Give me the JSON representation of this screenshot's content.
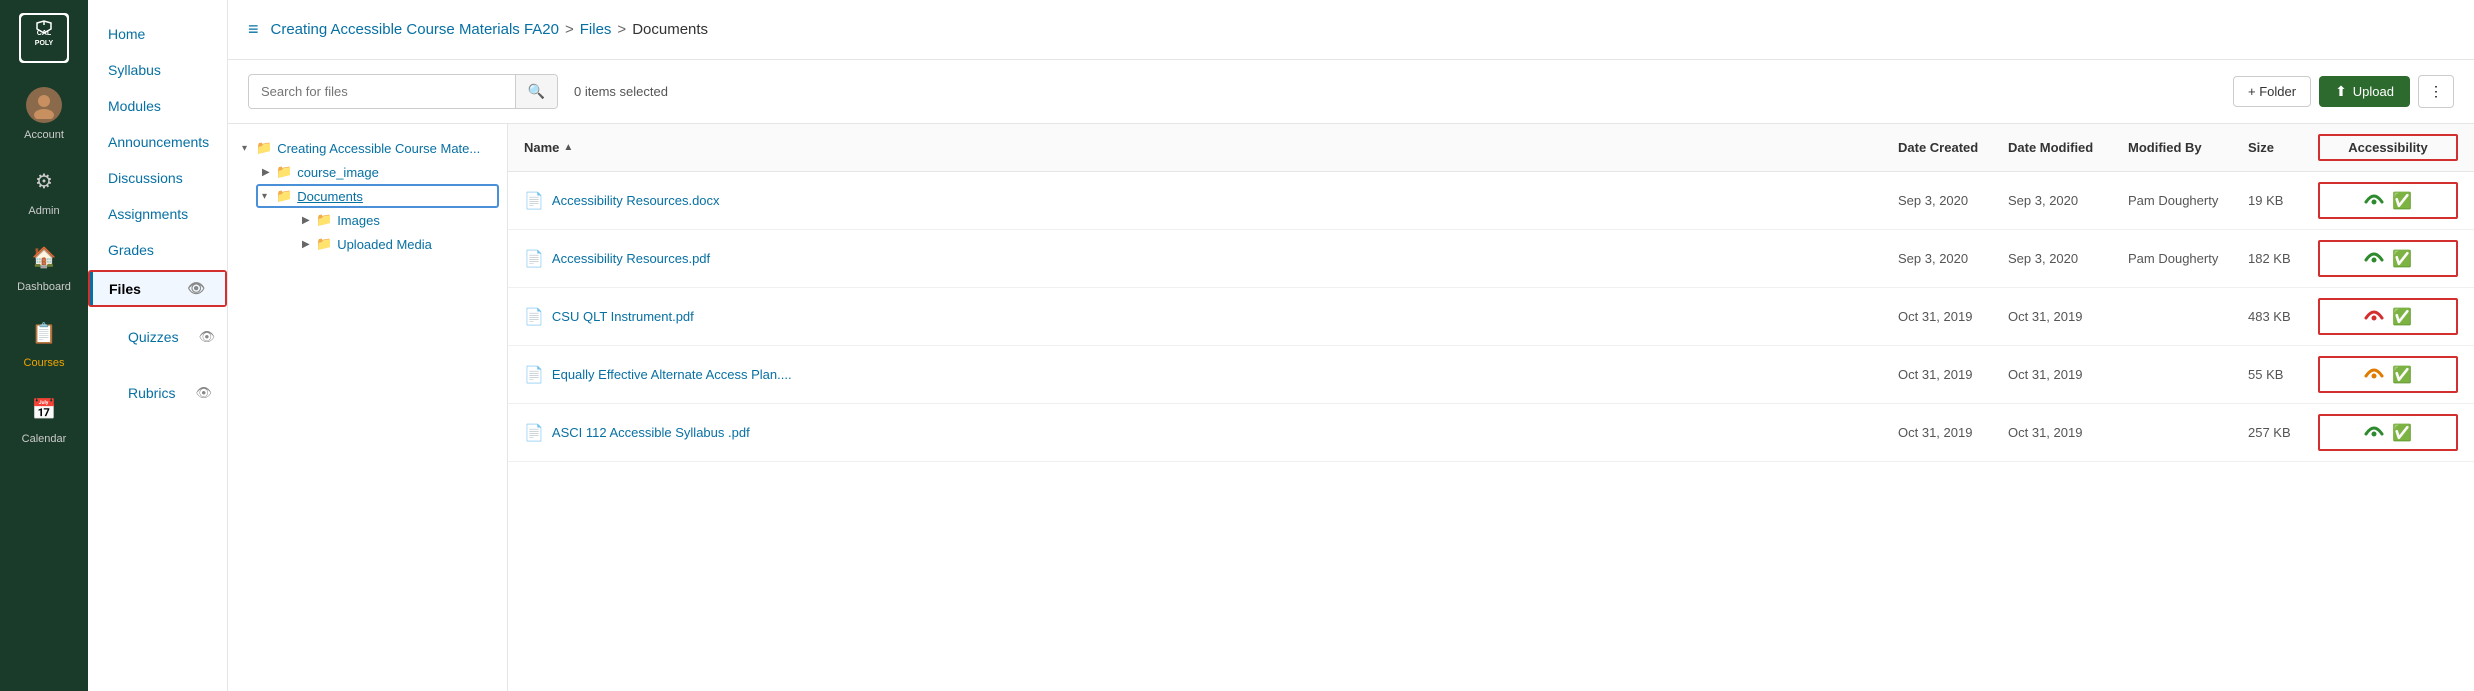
{
  "sidebar": {
    "logo": {
      "text": "CAL POLY"
    },
    "items": [
      {
        "id": "account",
        "label": "Account",
        "icon": "👤",
        "active": false
      },
      {
        "id": "admin",
        "label": "Admin",
        "icon": "⚙",
        "active": false
      },
      {
        "id": "dashboard",
        "label": "Dashboard",
        "icon": "🏠",
        "active": false
      },
      {
        "id": "courses",
        "label": "Courses",
        "icon": "📋",
        "active": true
      },
      {
        "id": "calendar",
        "label": "Calendar",
        "icon": "📅",
        "active": false
      }
    ]
  },
  "nav_panel": {
    "items": [
      {
        "id": "home",
        "label": "Home",
        "has_eye": false
      },
      {
        "id": "syllabus",
        "label": "Syllabus",
        "has_eye": false
      },
      {
        "id": "modules",
        "label": "Modules",
        "has_eye": false
      },
      {
        "id": "announcements",
        "label": "Announcements",
        "has_eye": false
      },
      {
        "id": "discussions",
        "label": "Discussions",
        "has_eye": false
      },
      {
        "id": "assignments",
        "label": "Assignments",
        "has_eye": false
      },
      {
        "id": "grades",
        "label": "Grades",
        "has_eye": false
      },
      {
        "id": "files",
        "label": "Files",
        "active": true,
        "has_eye": true
      },
      {
        "id": "quizzes",
        "label": "Quizzes",
        "has_eye": true
      },
      {
        "id": "rubrics",
        "label": "Rubrics",
        "has_eye": true
      }
    ]
  },
  "breadcrumb": {
    "course": "Creating Accessible Course Materials FA20",
    "files": "Files",
    "current": "Documents"
  },
  "toolbar": {
    "search_placeholder": "Search for files",
    "items_selected": "0 items selected",
    "folder_button": "+ Folder",
    "upload_button": "Upload",
    "more_button": "⋮"
  },
  "tree": {
    "root": "Creating Accessible Course Mate...",
    "children": [
      {
        "label": "course_image",
        "expanded": false,
        "selected": false
      },
      {
        "label": "Documents",
        "expanded": true,
        "selected": true,
        "children": [
          {
            "label": "Images",
            "expanded": false
          },
          {
            "label": "Uploaded Media",
            "expanded": false
          }
        ]
      }
    ]
  },
  "file_list": {
    "headers": {
      "name": "Name",
      "date_created": "Date Created",
      "date_modified": "Date Modified",
      "modified_by": "Modified By",
      "size": "Size",
      "accessibility": "Accessibility"
    },
    "files": [
      {
        "id": 1,
        "icon": "doc",
        "name": "Accessibility Resources.docx",
        "date_created": "Sep 3, 2020",
        "date_modified": "Sep 3, 2020",
        "modified_by": "Pam Dougherty",
        "size": "19 KB",
        "accessibility_status": "green",
        "check": "green"
      },
      {
        "id": 2,
        "icon": "pdf",
        "name": "Accessibility Resources.pdf",
        "date_created": "Sep 3, 2020",
        "date_modified": "Sep 3, 2020",
        "modified_by": "Pam Dougherty",
        "size": "182 KB",
        "accessibility_status": "green",
        "check": "green"
      },
      {
        "id": 3,
        "icon": "pdf",
        "name": "CSU QLT Instrument.pdf",
        "date_created": "Oct 31, 2019",
        "date_modified": "Oct 31, 2019",
        "modified_by": "",
        "size": "483 KB",
        "accessibility_status": "red",
        "check": "green"
      },
      {
        "id": 4,
        "icon": "doc",
        "name": "Equally Effective Alternate Access Plan....",
        "date_created": "Oct 31, 2019",
        "date_modified": "Oct 31, 2019",
        "modified_by": "",
        "size": "55 KB",
        "accessibility_status": "orange",
        "check": "green"
      },
      {
        "id": 5,
        "icon": "pdf",
        "name": "ASCI 112 Accessible Syllabus .pdf",
        "date_created": "Oct 31, 2019",
        "date_modified": "Oct 31, 2019",
        "modified_by": "",
        "size": "257 KB",
        "accessibility_status": "green",
        "check": "green"
      }
    ]
  }
}
